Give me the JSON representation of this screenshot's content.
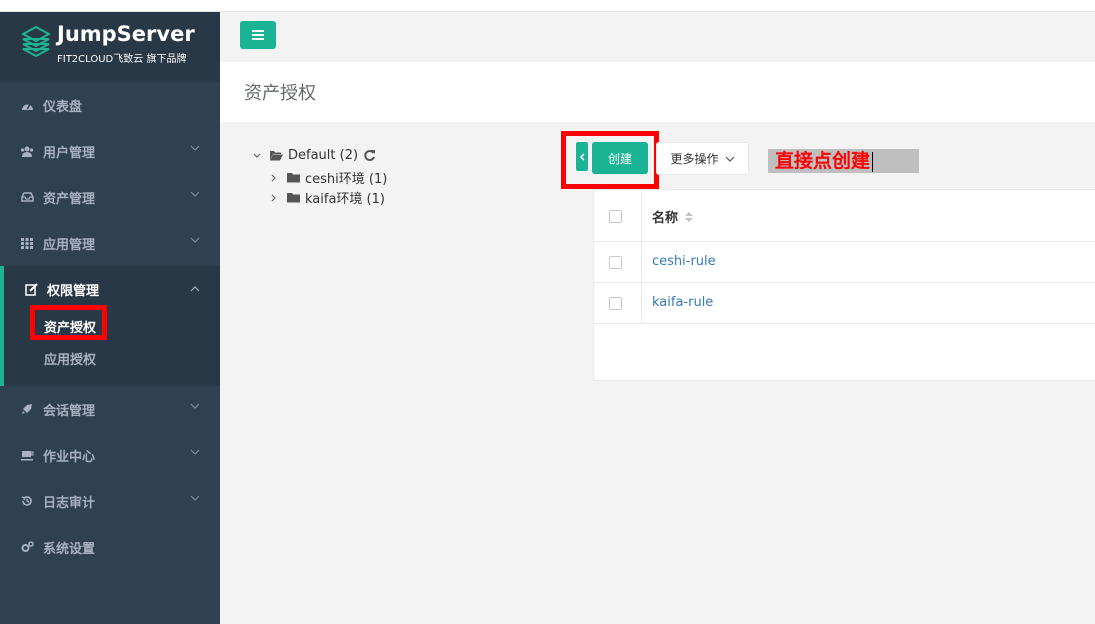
{
  "brand": {
    "title": "JumpServer",
    "subtitle": "FIT2CLOUD飞致云 旗下品牌"
  },
  "sidebar": {
    "items": [
      {
        "label": "仪表盘",
        "icon": "dashboard-icon"
      },
      {
        "label": "用户管理",
        "icon": "users-icon"
      },
      {
        "label": "资产管理",
        "icon": "inbox-icon"
      },
      {
        "label": "应用管理",
        "icon": "grid-icon"
      },
      {
        "label": "权限管理",
        "icon": "edit-icon",
        "active": true,
        "children": [
          {
            "label": "资产授权",
            "active": true
          },
          {
            "label": "应用授权"
          }
        ]
      },
      {
        "label": "会话管理",
        "icon": "rocket-icon"
      },
      {
        "label": "作业中心",
        "icon": "coffee-icon"
      },
      {
        "label": "日志审计",
        "icon": "history-icon"
      },
      {
        "label": "系统设置",
        "icon": "gears-icon"
      }
    ]
  },
  "page": {
    "title": "资产授权"
  },
  "tree": {
    "root": {
      "label": "Default (2)"
    },
    "children": [
      {
        "label": "ceshi环境 (1)"
      },
      {
        "label": "kaifa环境 (1)"
      }
    ]
  },
  "toolbar": {
    "create_label": "创建",
    "more_label": "更多操作"
  },
  "annotation": {
    "text": "直接点创建"
  },
  "table": {
    "header": {
      "name": "名称"
    },
    "rows": [
      {
        "name": "ceshi-rule"
      },
      {
        "name": "kaifa-rule"
      }
    ]
  },
  "colors": {
    "sidebar_bg": "#2f4050",
    "accent": "#1ab394",
    "link": "#337ab7",
    "highlight": "#ff0000"
  }
}
